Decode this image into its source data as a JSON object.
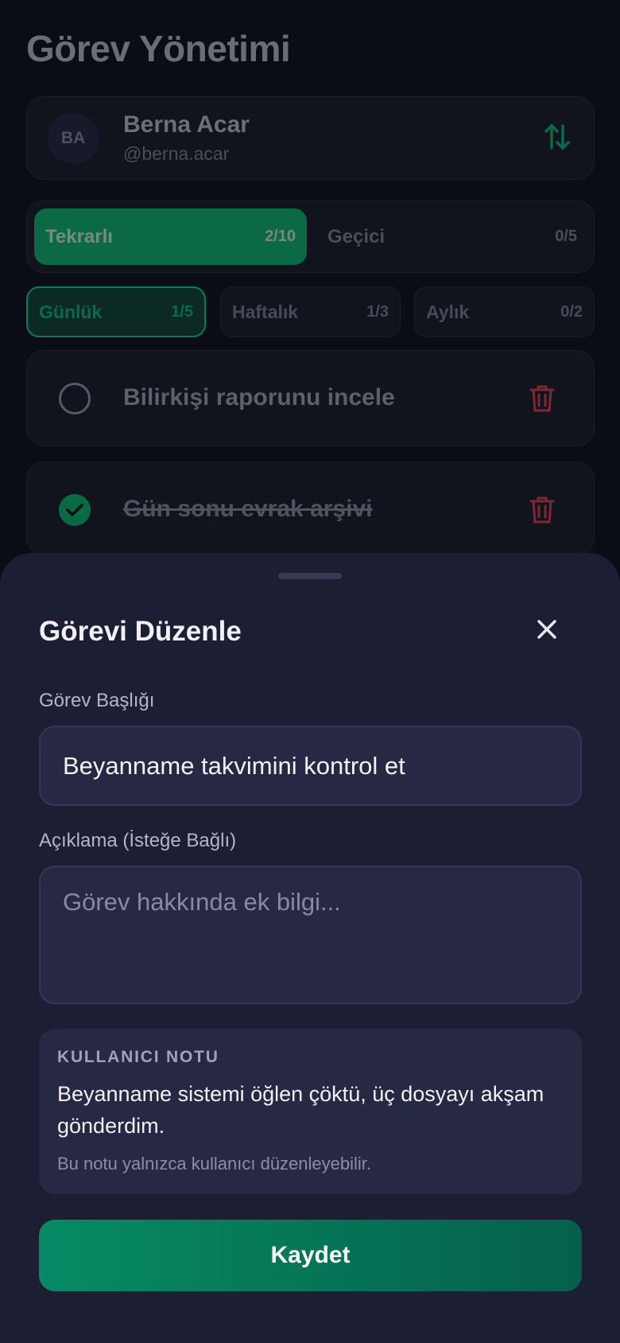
{
  "page": {
    "title": "Görev Yönetimi"
  },
  "user": {
    "initials": "BA",
    "name": "Berna Acar",
    "handle": "@berna.acar",
    "sort_icon": "sort-arrows-icon"
  },
  "task_type_tabs": [
    {
      "label": "Tekrarlı",
      "count": "2/10",
      "active": true
    },
    {
      "label": "Geçici",
      "count": "0/5",
      "active": false
    }
  ],
  "period_tabs": [
    {
      "label": "Günlük",
      "count": "1/5",
      "active": true
    },
    {
      "label": "Haftalık",
      "count": "1/3",
      "active": false
    },
    {
      "label": "Aylık",
      "count": "0/2",
      "active": false
    }
  ],
  "tasks": [
    {
      "title": "Bilirkişi raporunu incele",
      "completed": false,
      "delete_icon": "trash-icon"
    },
    {
      "title": "Gün sonu evrak arşivi",
      "completed": true,
      "delete_icon": "trash-icon"
    }
  ],
  "edit_sheet": {
    "title": "Görevi Düzenle",
    "close_icon": "close-icon",
    "title_label": "Görev Başlığı",
    "title_value": "Beyanname takvimini kontrol et",
    "description_label": "Açıklama (İsteğe Bağlı)",
    "description_value": "",
    "description_placeholder": "Görev hakkında ek bilgi...",
    "note": {
      "heading": "KULLANICI NOTU",
      "text": "Beyanname sistemi öğlen çöktü, üç dosyayı akşam gönderdim.",
      "hint": "Bu notu yalnızca kullanıcı düzenleyebilir."
    },
    "save_label": "Kaydet"
  },
  "colors": {
    "background": "#0b0d15",
    "sheet": "#1c1e33",
    "accent": "#068b64",
    "danger": "#7a2a30"
  }
}
